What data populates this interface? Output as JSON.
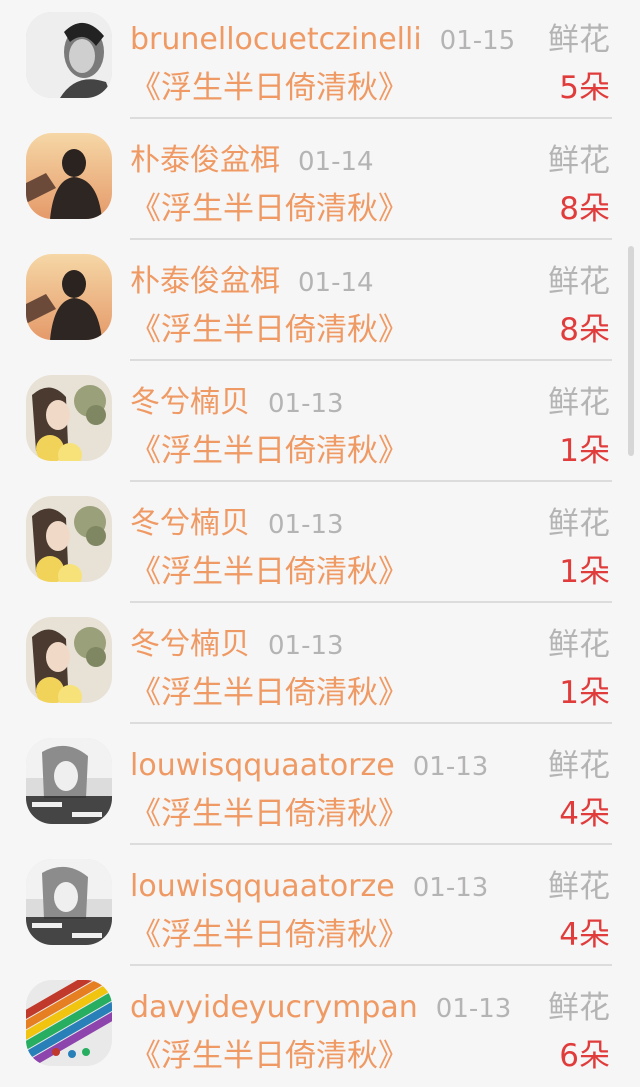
{
  "items": [
    {
      "name": "brunellocuetczinelli",
      "date": "01-15",
      "book": "《浮生半日倚清秋》",
      "gift": "鲜花",
      "count": "5朵",
      "avatar_icon": "bw-portrait-avatar"
    },
    {
      "name": "朴泰俊盆栮",
      "date": "01-14",
      "book": "《浮生半日倚清秋》",
      "gift": "鲜花",
      "count": "8朵",
      "avatar_icon": "sunset-silhouette-avatar"
    },
    {
      "name": "朴泰俊盆栮",
      "date": "01-14",
      "book": "《浮生半日倚清秋》",
      "gift": "鲜花",
      "count": "8朵",
      "avatar_icon": "sunset-silhouette-avatar"
    },
    {
      "name": "冬兮楠贝",
      "date": "01-13",
      "book": "《浮生半日倚清秋》",
      "gift": "鲜花",
      "count": "1朵",
      "avatar_icon": "girl-flowers-avatar"
    },
    {
      "name": "冬兮楠贝",
      "date": "01-13",
      "book": "《浮生半日倚清秋》",
      "gift": "鲜花",
      "count": "1朵",
      "avatar_icon": "girl-flowers-avatar"
    },
    {
      "name": "冬兮楠贝",
      "date": "01-13",
      "book": "《浮生半日倚清秋》",
      "gift": "鲜花",
      "count": "1朵",
      "avatar_icon": "girl-flowers-avatar"
    },
    {
      "name": "louwisqquaatorze",
      "date": "01-13",
      "book": "《浮生半日倚清秋》",
      "gift": "鲜花",
      "count": "4朵",
      "avatar_icon": "grey-girl-caption-avatar"
    },
    {
      "name": "louwisqquaatorze",
      "date": "01-13",
      "book": "《浮生半日倚清秋》",
      "gift": "鲜花",
      "count": "4朵",
      "avatar_icon": "grey-girl-caption-avatar"
    },
    {
      "name": "davyideyucrympan",
      "date": "01-13",
      "book": "《浮生半日倚清秋》",
      "gift": "鲜花",
      "count": "6朵",
      "avatar_icon": "color-pencils-avatar"
    }
  ],
  "colors": {
    "name": "#ef9a64",
    "meta": "#b4b4b4",
    "count": "#e13c3c",
    "background": "#f7f6f6"
  }
}
